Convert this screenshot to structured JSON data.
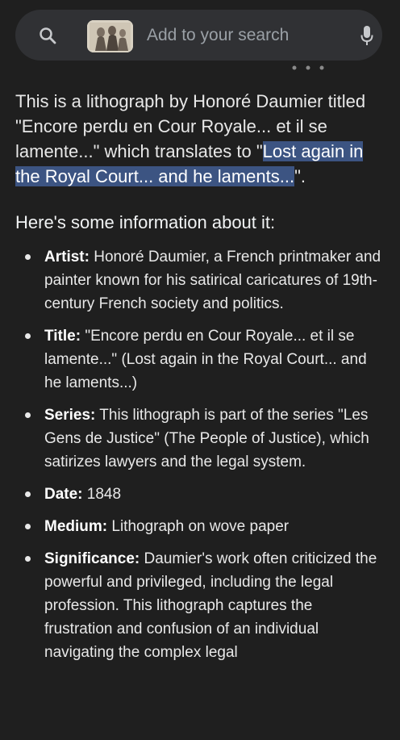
{
  "search": {
    "placeholder": "Add to your search",
    "icon": "search-icon",
    "mic_icon": "mic-icon"
  },
  "answer": {
    "intro_text": "This is a lithograph by Honoré Daumier titled \"Encore perdu en Cour Royale... et il se lamente...\" which translates to \"",
    "intro_highlight": "Lost again in the Royal Court... and he laments...",
    "intro_end": "\".",
    "section_heading": "Here's some information about it:",
    "items": [
      {
        "label": "Artist:",
        "text": " Honoré Daumier, a French printmaker and painter known for his satirical caricatures of 19th-century French society and politics."
      },
      {
        "label": "Title:",
        "text": " \"Encore perdu en Cour Royale... et il se lamente...\" (Lost again in the Royal Court... and he laments...)"
      },
      {
        "label": "Series:",
        "text": " This lithograph is part of the series \"Les Gens de Justice\" (The People of Justice), which satirizes lawyers and the legal system."
      },
      {
        "label": "Date:",
        "text": " 1848"
      },
      {
        "label": "Medium:",
        "text": " Lithograph on wove paper"
      },
      {
        "label": "Significance:",
        "text": " Daumier's work often criticized the powerful and privileged, including the legal profession. This lithograph captures the frustration and confusion of an individual navigating the complex legal"
      }
    ]
  },
  "colors": {
    "background": "#1f1f1f",
    "search_bar": "#303134",
    "highlight": "#3c5482",
    "text": "#e8e8e8"
  }
}
